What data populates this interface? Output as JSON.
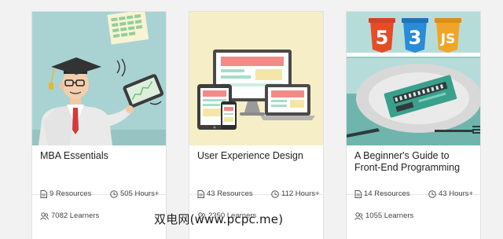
{
  "courses": [
    {
      "title": "MBA Essentials",
      "resources": "9 Resources",
      "hours": "505 Hours+",
      "learners": "7082 Learners",
      "art_bg": "#a9d3d2"
    },
    {
      "title": "User Experience Design",
      "resources": "43 Resources",
      "hours": "112 Hours+",
      "learners": "2350 Learners",
      "art_bg": "#f6eec6"
    },
    {
      "title": "A Beginner's Guide to Front-End Programming",
      "resources": "14 Resources",
      "hours": "43 Hours+",
      "learners": "1055 Learners",
      "art_bg": "#b6dcda"
    }
  ],
  "badges": {
    "html": "5",
    "css": "3",
    "js": "JS"
  },
  "watermark": "双电网(www.pcpc.me)",
  "icons": [
    "document-icon",
    "clock-icon",
    "users-icon"
  ]
}
